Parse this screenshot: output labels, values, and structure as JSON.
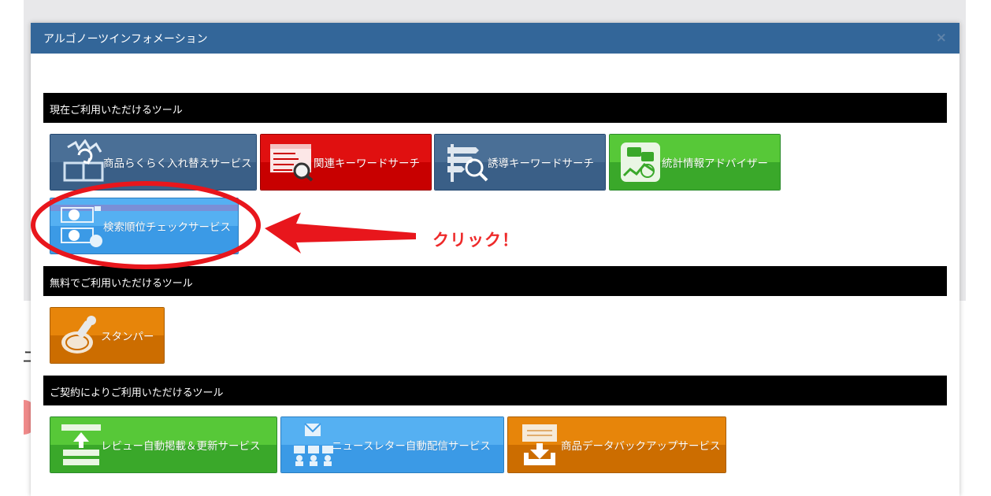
{
  "background": {
    "glyph": "ニ"
  },
  "modal": {
    "title": "アルゴノーツインフォメーション",
    "close": "×"
  },
  "sections": [
    {
      "title": "現在ご利用いただけるツール",
      "tools": [
        {
          "label": "商品らくらく入れ替えサービス",
          "color": "#3a5f87",
          "icon": "box-swap-icon"
        },
        {
          "label": "関連キーワードサーチ",
          "color": "#c80000",
          "icon": "keyword-list-search-icon"
        },
        {
          "label": "誘導キーワードサーチ",
          "color": "#3a5f87",
          "icon": "signpost-search-icon"
        },
        {
          "label": "統計情報アドバイザー",
          "color": "#3aa82a",
          "icon": "chat-chart-icon"
        },
        {
          "label": "検索順位チェックサービス",
          "color": "#3b9ae6",
          "icon": "rank-check-icon"
        }
      ]
    },
    {
      "title": "無料でご利用いただけるツール",
      "tools": [
        {
          "label": "スタンパー",
          "color": "#cc6d00",
          "icon": "stamp-icon"
        }
      ]
    },
    {
      "title": "ご契約によりご利用いただけるツール",
      "tools": [
        {
          "label": "レビュー自動掲載＆更新サービス",
          "color": "#3aa82a",
          "icon": "review-upload-icon"
        },
        {
          "label": "ニュースレター自動配信サービス",
          "color": "#3b9ae6",
          "icon": "newsletter-icon"
        },
        {
          "label": "商品データバックアップサービス",
          "color": "#cc6d00",
          "icon": "backup-download-icon"
        }
      ]
    }
  ],
  "annotation": {
    "text": "クリック！",
    "color": "#ee2a2a"
  }
}
